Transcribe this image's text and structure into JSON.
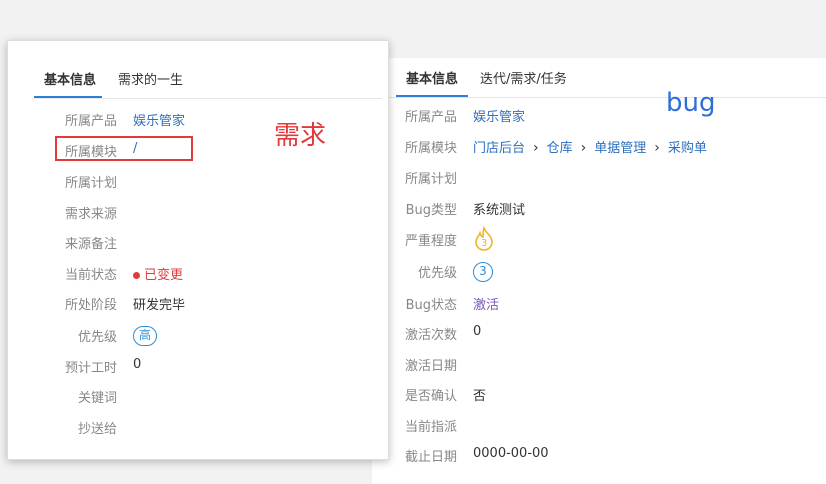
{
  "bug_panel": {
    "tabs": [
      {
        "label": "基本信息"
      },
      {
        "label": "迭代/需求/任务"
      }
    ],
    "annotation": "bug",
    "fields": {
      "product": {
        "label": "所属产品",
        "value": "娱乐管家"
      },
      "module": {
        "label": "所属模块",
        "path": [
          "门店后台",
          "仓库",
          "单据管理",
          "采购单"
        ],
        "separator": "›"
      },
      "plan": {
        "label": "所属计划",
        "value": ""
      },
      "bug_type": {
        "label": "Bug类型",
        "value": "系统测试"
      },
      "severity": {
        "label": "严重程度",
        "value": "3"
      },
      "priority": {
        "label": "优先级",
        "value": "3"
      },
      "status": {
        "label": "Bug状态",
        "value": "激活"
      },
      "activated_count": {
        "label": "激活次数",
        "value": "0"
      },
      "activated_date": {
        "label": "激活日期",
        "value": ""
      },
      "confirmed": {
        "label": "是否确认",
        "value": "否"
      },
      "assigned_to": {
        "label": "当前指派",
        "value": ""
      },
      "deadline": {
        "label": "截止日期",
        "value": "0000-00-00"
      }
    }
  },
  "story_panel": {
    "tabs": [
      {
        "label": "基本信息"
      },
      {
        "label": "需求的一生"
      }
    ],
    "annotation": "需求",
    "fields": {
      "product": {
        "label": "所属产品",
        "value": "娱乐管家"
      },
      "module": {
        "label": "所属模块",
        "value": "/"
      },
      "plan": {
        "label": "所属计划",
        "value": ""
      },
      "source": {
        "label": "需求来源",
        "value": ""
      },
      "source_note": {
        "label": "来源备注",
        "value": ""
      },
      "status": {
        "label": "当前状态",
        "value": "已变更"
      },
      "stage": {
        "label": "所处阶段",
        "value": "研发完毕"
      },
      "priority": {
        "label": "优先级",
        "value": "高"
      },
      "estimate": {
        "label": "预计工时",
        "value": "0"
      },
      "keywords": {
        "label": "关键词",
        "value": ""
      },
      "mailto": {
        "label": "抄送给",
        "value": ""
      }
    }
  },
  "colors": {
    "accent": "#2e7fd8",
    "annotation_red": "#e23a3a",
    "annotation_blue": "#2e6fd8",
    "status_purple": "#7b55b8"
  }
}
